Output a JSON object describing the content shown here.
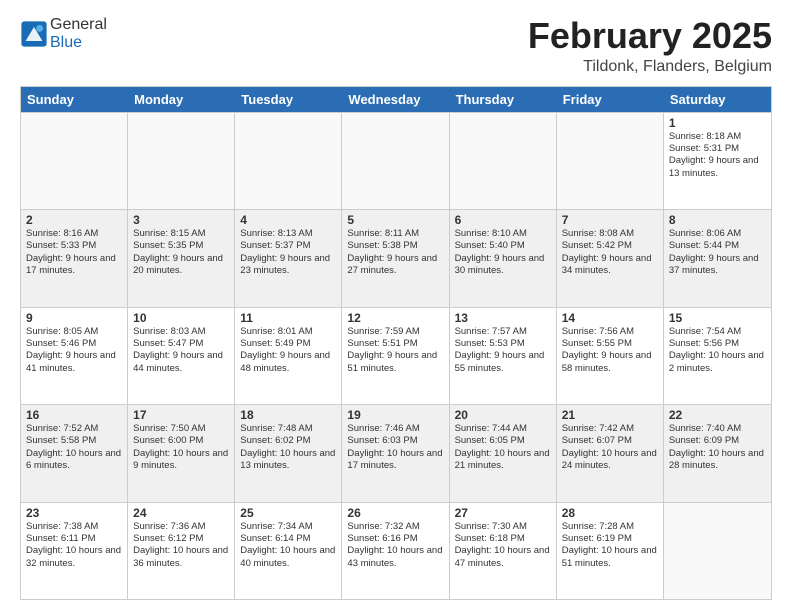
{
  "header": {
    "logo_general": "General",
    "logo_blue": "Blue",
    "month_title": "February 2025",
    "location": "Tildonk, Flanders, Belgium"
  },
  "day_headers": [
    "Sunday",
    "Monday",
    "Tuesday",
    "Wednesday",
    "Thursday",
    "Friday",
    "Saturday"
  ],
  "weeks": [
    [
      {
        "day": "",
        "info": "",
        "empty": true
      },
      {
        "day": "",
        "info": "",
        "empty": true
      },
      {
        "day": "",
        "info": "",
        "empty": true
      },
      {
        "day": "",
        "info": "",
        "empty": true
      },
      {
        "day": "",
        "info": "",
        "empty": true
      },
      {
        "day": "",
        "info": "",
        "empty": true
      },
      {
        "day": "1",
        "info": "Sunrise: 8:18 AM\nSunset: 5:31 PM\nDaylight: 9 hours and 13 minutes."
      }
    ],
    [
      {
        "day": "2",
        "info": "Sunrise: 8:16 AM\nSunset: 5:33 PM\nDaylight: 9 hours and 17 minutes."
      },
      {
        "day": "3",
        "info": "Sunrise: 8:15 AM\nSunset: 5:35 PM\nDaylight: 9 hours and 20 minutes."
      },
      {
        "day": "4",
        "info": "Sunrise: 8:13 AM\nSunset: 5:37 PM\nDaylight: 9 hours and 23 minutes."
      },
      {
        "day": "5",
        "info": "Sunrise: 8:11 AM\nSunset: 5:38 PM\nDaylight: 9 hours and 27 minutes."
      },
      {
        "day": "6",
        "info": "Sunrise: 8:10 AM\nSunset: 5:40 PM\nDaylight: 9 hours and 30 minutes."
      },
      {
        "day": "7",
        "info": "Sunrise: 8:08 AM\nSunset: 5:42 PM\nDaylight: 9 hours and 34 minutes."
      },
      {
        "day": "8",
        "info": "Sunrise: 8:06 AM\nSunset: 5:44 PM\nDaylight: 9 hours and 37 minutes."
      }
    ],
    [
      {
        "day": "9",
        "info": "Sunrise: 8:05 AM\nSunset: 5:46 PM\nDaylight: 9 hours and 41 minutes."
      },
      {
        "day": "10",
        "info": "Sunrise: 8:03 AM\nSunset: 5:47 PM\nDaylight: 9 hours and 44 minutes."
      },
      {
        "day": "11",
        "info": "Sunrise: 8:01 AM\nSunset: 5:49 PM\nDaylight: 9 hours and 48 minutes."
      },
      {
        "day": "12",
        "info": "Sunrise: 7:59 AM\nSunset: 5:51 PM\nDaylight: 9 hours and 51 minutes."
      },
      {
        "day": "13",
        "info": "Sunrise: 7:57 AM\nSunset: 5:53 PM\nDaylight: 9 hours and 55 minutes."
      },
      {
        "day": "14",
        "info": "Sunrise: 7:56 AM\nSunset: 5:55 PM\nDaylight: 9 hours and 58 minutes."
      },
      {
        "day": "15",
        "info": "Sunrise: 7:54 AM\nSunset: 5:56 PM\nDaylight: 10 hours and 2 minutes."
      }
    ],
    [
      {
        "day": "16",
        "info": "Sunrise: 7:52 AM\nSunset: 5:58 PM\nDaylight: 10 hours and 6 minutes."
      },
      {
        "day": "17",
        "info": "Sunrise: 7:50 AM\nSunset: 6:00 PM\nDaylight: 10 hours and 9 minutes."
      },
      {
        "day": "18",
        "info": "Sunrise: 7:48 AM\nSunset: 6:02 PM\nDaylight: 10 hours and 13 minutes."
      },
      {
        "day": "19",
        "info": "Sunrise: 7:46 AM\nSunset: 6:03 PM\nDaylight: 10 hours and 17 minutes."
      },
      {
        "day": "20",
        "info": "Sunrise: 7:44 AM\nSunset: 6:05 PM\nDaylight: 10 hours and 21 minutes."
      },
      {
        "day": "21",
        "info": "Sunrise: 7:42 AM\nSunset: 6:07 PM\nDaylight: 10 hours and 24 minutes."
      },
      {
        "day": "22",
        "info": "Sunrise: 7:40 AM\nSunset: 6:09 PM\nDaylight: 10 hours and 28 minutes."
      }
    ],
    [
      {
        "day": "23",
        "info": "Sunrise: 7:38 AM\nSunset: 6:11 PM\nDaylight: 10 hours and 32 minutes."
      },
      {
        "day": "24",
        "info": "Sunrise: 7:36 AM\nSunset: 6:12 PM\nDaylight: 10 hours and 36 minutes."
      },
      {
        "day": "25",
        "info": "Sunrise: 7:34 AM\nSunset: 6:14 PM\nDaylight: 10 hours and 40 minutes."
      },
      {
        "day": "26",
        "info": "Sunrise: 7:32 AM\nSunset: 6:16 PM\nDaylight: 10 hours and 43 minutes."
      },
      {
        "day": "27",
        "info": "Sunrise: 7:30 AM\nSunset: 6:18 PM\nDaylight: 10 hours and 47 minutes."
      },
      {
        "day": "28",
        "info": "Sunrise: 7:28 AM\nSunset: 6:19 PM\nDaylight: 10 hours and 51 minutes."
      },
      {
        "day": "",
        "info": "",
        "empty": true
      }
    ]
  ]
}
